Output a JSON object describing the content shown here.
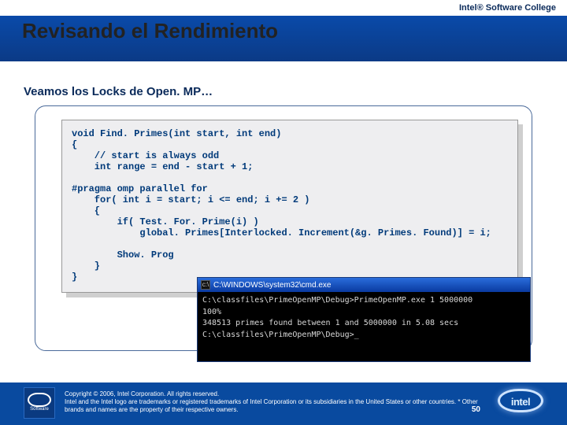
{
  "header": {
    "college": "Intel® Software College",
    "title": "Revisando el Rendimiento"
  },
  "subhead": "Veamos los Locks de Open. MP…",
  "code": "void Find. Primes(int start, int end)\n{\n    // start is always odd\n    int range = end - start + 1;\n\n#pragma omp parallel for\n    for( int i = start; i <= end; i += 2 )\n    {\n        if( Test. For. Prime(i) )\n            global. Primes[Interlocked. Increment(&g. Primes. Found)] = i;\n\n        Show. Prog\n    }\n}",
  "cmd": {
    "title": "C:\\WINDOWS\\system32\\cmd.exe",
    "lines": [
      "C:\\classfiles\\PrimeOpenMP\\Debug>PrimeOpenMP.exe 1 5000000",
      "100%",
      "348513 primes found between       1 and 5000000 in   5.08 secs",
      "",
      "C:\\classfiles\\PrimeOpenMP\\Debug>_"
    ]
  },
  "footer": {
    "copyright": "Copyright © 2006, Intel Corporation. All rights reserved.",
    "legal": "Intel and the Intel logo are trademarks or registered trademarks of Intel Corporation or its subsidiaries in the United States or other countries. * Other brands and names are the property of their respective owners.",
    "slide_number": "50",
    "left_badge": "Software",
    "brand": "intel"
  }
}
